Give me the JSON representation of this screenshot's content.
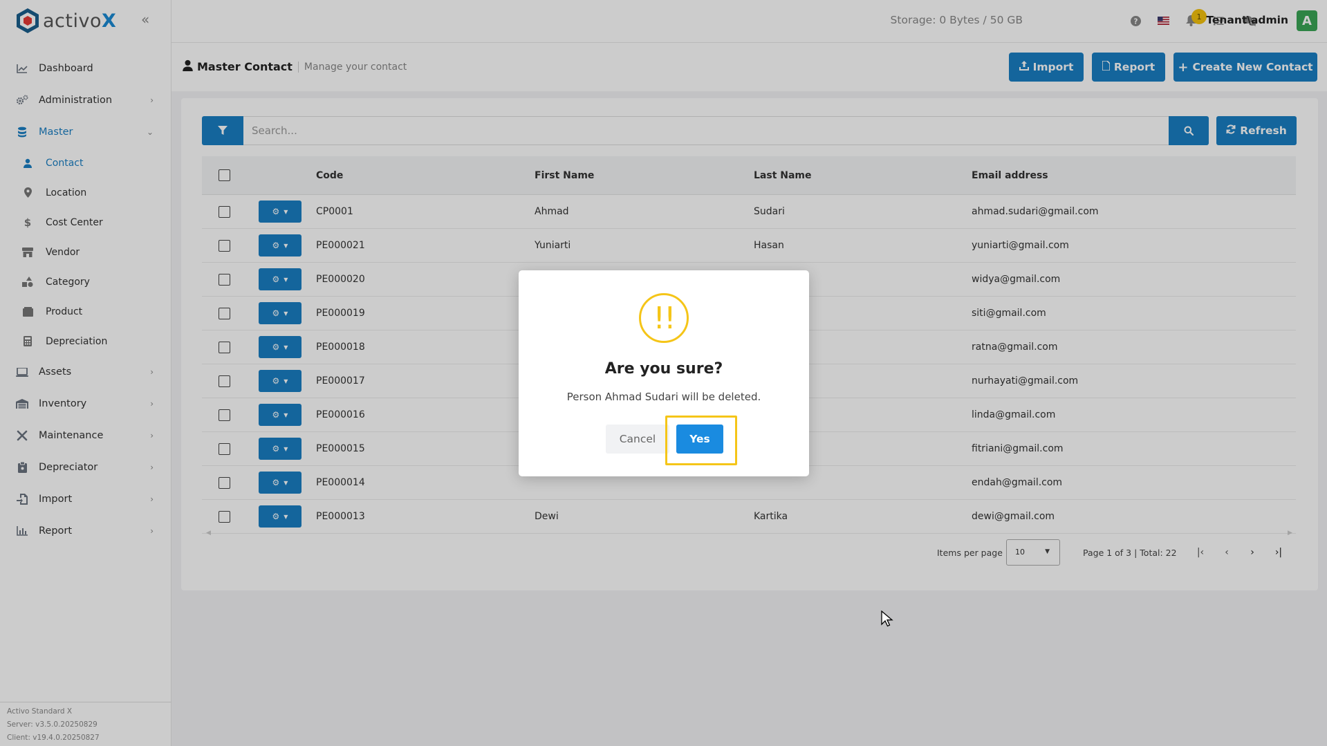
{
  "brand": {
    "name_prefix": "activo",
    "name_suffix": "X"
  },
  "topbar": {
    "storage": "Storage: 0 Bytes / 50 GB",
    "notification_count": "1",
    "user": "Tenant\\admin",
    "avatar_letter": "A"
  },
  "sidebar": {
    "items": [
      {
        "label": "Dashboard",
        "icon": "chart-line-icon"
      },
      {
        "label": "Administration",
        "icon": "gears-icon"
      },
      {
        "label": "Master",
        "icon": "database-icon"
      },
      {
        "label": "Assets",
        "icon": "laptop-icon"
      },
      {
        "label": "Inventory",
        "icon": "warehouse-icon"
      },
      {
        "label": "Maintenance",
        "icon": "tools-icon"
      },
      {
        "label": "Depreciator",
        "icon": "clipboard-icon"
      },
      {
        "label": "Import",
        "icon": "file-import-icon"
      },
      {
        "label": "Report",
        "icon": "chart-bar-icon"
      }
    ],
    "master_sub": [
      {
        "label": "Contact",
        "icon": "user-icon"
      },
      {
        "label": "Location",
        "icon": "map-marker-icon"
      },
      {
        "label": "Cost Center",
        "icon": "dollar-icon"
      },
      {
        "label": "Vendor",
        "icon": "store-icon"
      },
      {
        "label": "Category",
        "icon": "shapes-icon"
      },
      {
        "label": "Product",
        "icon": "box-icon"
      },
      {
        "label": "Depreciation",
        "icon": "calculator-icon"
      }
    ],
    "version": {
      "line1": "Activo Standard X",
      "line2": "Server: v3.5.0.20250829",
      "line3": "Client: v19.4.0.20250827"
    }
  },
  "page": {
    "title": "Master Contact",
    "subtitle": "Manage your contact",
    "import_label": "Import",
    "report_label": "Report",
    "create_label": "Create New Contact"
  },
  "search": {
    "placeholder": "Search...",
    "refresh_label": "Refresh"
  },
  "table": {
    "headers": {
      "code": "Code",
      "first": "First Name",
      "last": "Last Name",
      "email": "Email address"
    },
    "rows": [
      {
        "code": "CP0001",
        "first": "Ahmad",
        "last": "Sudari",
        "email": "ahmad.sudari@gmail.com"
      },
      {
        "code": "PE000021",
        "first": "Yuniarti",
        "last": "Hasan",
        "email": "yuniarti@gmail.com"
      },
      {
        "code": "PE000020",
        "first": "",
        "last": "",
        "email": "widya@gmail.com"
      },
      {
        "code": "PE000019",
        "first": "",
        "last": "",
        "email": "siti@gmail.com"
      },
      {
        "code": "PE000018",
        "first": "",
        "last": "",
        "email": "ratna@gmail.com"
      },
      {
        "code": "PE000017",
        "first": "",
        "last": "",
        "email": "nurhayati@gmail.com"
      },
      {
        "code": "PE000016",
        "first": "",
        "last": "",
        "email": "linda@gmail.com"
      },
      {
        "code": "PE000015",
        "first": "",
        "last": "",
        "email": "fitriani@gmail.com"
      },
      {
        "code": "PE000014",
        "first": "",
        "last": "",
        "email": "endah@gmail.com"
      },
      {
        "code": "PE000013",
        "first": "Dewi",
        "last": "Kartika",
        "email": "dewi@gmail.com"
      }
    ]
  },
  "pagination": {
    "items_per_page_label": "Items per page",
    "items_per_page_value": "10",
    "range_text": "Page 1 of 3 | Total: 22"
  },
  "dialog": {
    "icon": "!!",
    "title": "Are you sure?",
    "message": "Person Ahmad Sudari will be deleted.",
    "cancel_label": "Cancel",
    "confirm_label": "Yes"
  },
  "colors": {
    "primary": "#1a7fc4",
    "warning": "#f5c518",
    "avatar": "#3aa655"
  }
}
